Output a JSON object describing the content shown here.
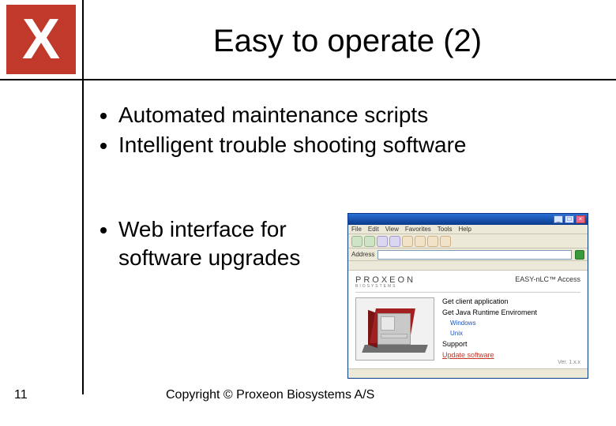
{
  "logo_letter": "X",
  "title": "Easy to operate (2)",
  "bullets": {
    "b1": "Automated maintenance scripts",
    "b2": "Intelligent trouble shooting software",
    "b3": "Web interface for software upgrades"
  },
  "page_number": "11",
  "copyright": "Copyright ©  Proxeon Biosystems A/S",
  "browser": {
    "window_title": " ",
    "menu": {
      "file": "File",
      "edit": "Edit",
      "view": "View",
      "fav": "Favorites",
      "tools": "Tools",
      "help": "Help"
    },
    "address_label": "Address",
    "brand": "PROXEON",
    "brand_sub": "BIOSYSTEMS",
    "product": "EASY-nLC™ Access",
    "links": {
      "get_client": "Get client application",
      "get_jre": "Get Java Runtime Enviroment",
      "win": "Windows",
      "unix": "Unix",
      "support": "Support",
      "update": "Update software"
    },
    "version": "Ver. 1.x.x"
  }
}
